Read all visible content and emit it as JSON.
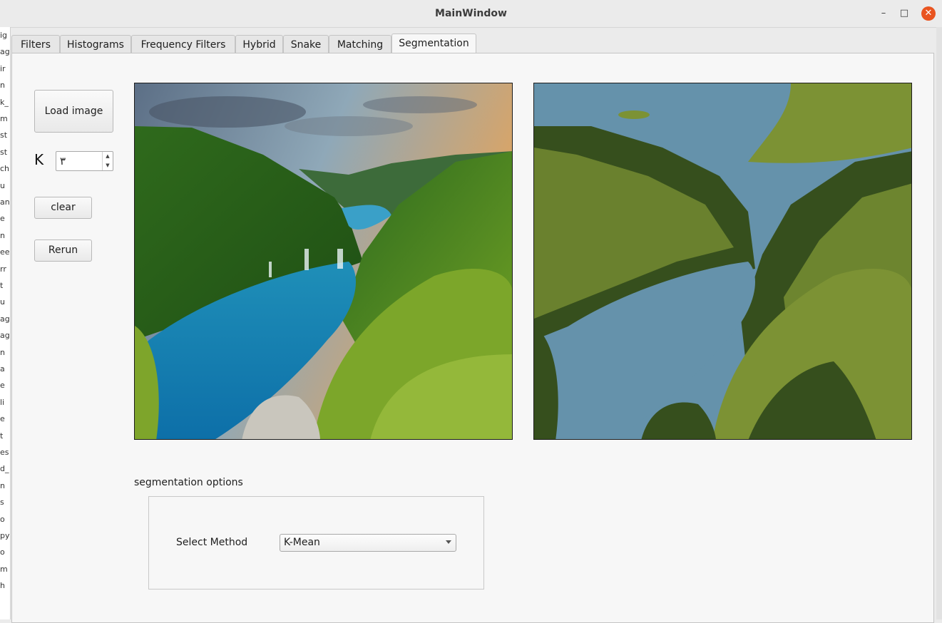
{
  "window": {
    "title": "MainWindow",
    "minimize_glyph": "–",
    "maximize_glyph": "□",
    "close_glyph": "✕"
  },
  "tabs": [
    {
      "label": "Filters"
    },
    {
      "label": "Histograms"
    },
    {
      "label": "Frequency Filters"
    },
    {
      "label": "Hybrid"
    },
    {
      "label": "Snake"
    },
    {
      "label": "Matching"
    },
    {
      "label": "Segmentation",
      "active": true
    }
  ],
  "controls": {
    "load_label": "Load image",
    "k_label": "K",
    "k_value": "٣",
    "clear_label": "clear",
    "rerun_label": "Rerun"
  },
  "images": {
    "original_icon": "landscape-photo",
    "segmented_icon": "kmeans-segmented-photo",
    "segment_colors": [
      "#6592ab",
      "#364f1d",
      "#7c9234"
    ]
  },
  "options": {
    "group_title": "segmentation options",
    "method_label": "Select Method",
    "method_value": "K-Mean"
  },
  "background_window": {
    "fragments": [
      "ig",
      "ag",
      "ir",
      "n",
      "k_",
      "m",
      "st",
      "st",
      "ch",
      "u",
      "an",
      "e",
      "n",
      "ee",
      "rr",
      "t",
      "u",
      "ag",
      "ag",
      "n",
      "a",
      "e",
      "li",
      "e",
      "t",
      "es",
      "d_",
      "n",
      "s",
      "o",
      "py",
      "o",
      "m",
      "h"
    ]
  }
}
